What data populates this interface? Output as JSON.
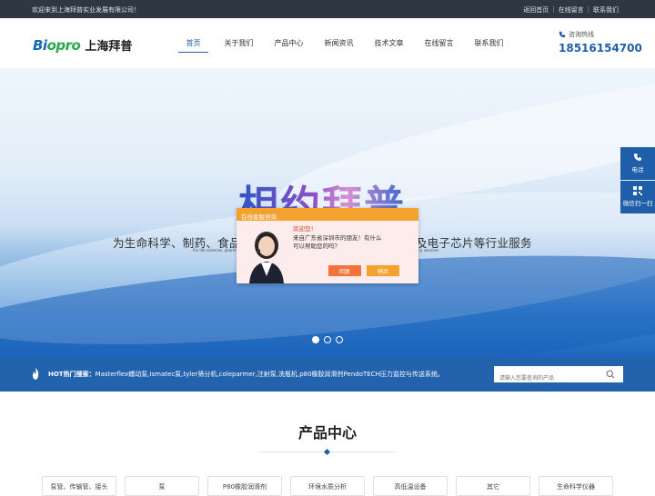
{
  "topbar": {
    "welcome": "欢迎来到上海拜普实业发展有限公司！",
    "links": [
      "返回首页",
      "在线留言",
      "联系我们"
    ]
  },
  "logo": {
    "mark_b": "Bi",
    "mark_rest": "opro",
    "company": "上海拜普"
  },
  "nav": {
    "items": [
      "首页",
      "关于我们",
      "产品中心",
      "新闻资讯",
      "技术文章",
      "在线留言",
      "联系我们"
    ]
  },
  "hotline": {
    "label": "咨询热线",
    "number": "18516154700"
  },
  "banner": {
    "big_text": "相约拜普",
    "subtitle": "为生命科学、制药、食品、化学、水处理、环境、石油化工及电子芯片等行业服务",
    "tiny_text": "For life sciences, pharmaceutical, food, chemical, water treatment, environmental, petrochemical and electronic chip industry services",
    "dots": 3,
    "active_dot": 0
  },
  "chat": {
    "header": "在线客服咨询",
    "greeting": "欢迎您！",
    "line1": "来自广东省深圳市的朋友！有什么",
    "line2": "可以帮助您的吗？",
    "reply": "回复",
    "later": "稍后"
  },
  "side": {
    "phone": "电话",
    "wechat": "微信扫一扫"
  },
  "hotbar": {
    "label": "HOT热门搜索：",
    "keywords": "Masterflex蠕动泵,Ismatec泵,tyler筛分机,coleparmer,注射泵,洗瓶机,p80橡胶润滑剂PendoTECH压力监控与传送系统。一次..."
  },
  "search": {
    "placeholder": "请输入您要查询的产品"
  },
  "products": {
    "title": "产品中心",
    "categories": [
      "泵管、传输管、接头",
      "泵",
      "P80橡胶润滑剂",
      "环境水质分析",
      "高低温设备",
      "其它",
      "生命科学仪器"
    ]
  },
  "colors": {
    "primary": "#1f5ea8",
    "topbar": "#2f3742",
    "chat_orange": "#f3a12f"
  }
}
